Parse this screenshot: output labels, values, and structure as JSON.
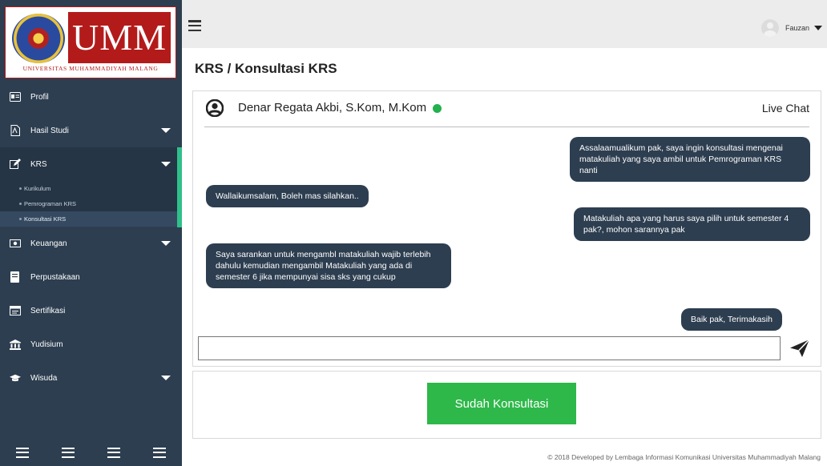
{
  "brand": {
    "logo_text": "UMM",
    "logo_subtitle": "UNIVERSITAS MUHAMMADIYAH MALANG",
    "colors": {
      "logo_red": "#b31b1b",
      "sidebar": "#2d3e50",
      "accent_green": "#2fbf8a",
      "button_green": "#2eb84a"
    }
  },
  "sidebar": {
    "items": [
      {
        "label": "Profil",
        "icon": "id-card-icon"
      },
      {
        "label": "Hasil Studi",
        "icon": "document-icon",
        "has_caret": true
      },
      {
        "label": "KRS",
        "icon": "edit-icon",
        "has_caret": true,
        "active": true
      },
      {
        "label": "Keuangan",
        "icon": "money-icon",
        "has_caret": true
      },
      {
        "label": "Perpustakaan",
        "icon": "book-icon"
      },
      {
        "label": "Sertifikasi",
        "icon": "certificate-icon"
      },
      {
        "label": "Yudisium",
        "icon": "institution-icon"
      },
      {
        "label": "Wisuda",
        "icon": "graduation-cap-icon",
        "has_caret": true
      }
    ],
    "krs_submenu": [
      "Kurikulum",
      "Pemrograman KRS",
      "Konsultasi KRS"
    ],
    "current_submenu": "Konsultasi KRS"
  },
  "topbar": {
    "user_name": "Fauzan"
  },
  "page": {
    "breadcrumb": "KRS / Konsultasi KRS"
  },
  "chat": {
    "advisor_name": "Denar Regata Akbi, S.Kom, M.Kom",
    "status": "online",
    "mode_label": "Live Chat",
    "messages": [
      {
        "from": "student",
        "text": "Assalaamualikum pak, saya ingin konsultasi mengenai matakuliah yang saya ambil untuk Pemrograman KRS nanti"
      },
      {
        "from": "advisor",
        "text": "Wallaikumsalam, Boleh mas silahkan.."
      },
      {
        "from": "student",
        "text": "Matakuliah apa yang harus saya pilih untuk semester 4 pak?, mohon sarannya pak"
      },
      {
        "from": "advisor",
        "text": "Saya sarankan untuk mengambl matakuliah wajib terlebih dahulu kemudian mengambil Matakuliah yang ada di semester 6 jika mempunyai sisa sks yang cukup"
      },
      {
        "from": "student",
        "text": "Baik pak, Terimakasih"
      }
    ],
    "input_value": ""
  },
  "actions": {
    "done_label": "Sudah Konsultasi"
  },
  "footer": {
    "text": "© 2018 Developed by Lembaga Informasi Komunikasi Universitas Muhammadiyah Malang"
  }
}
